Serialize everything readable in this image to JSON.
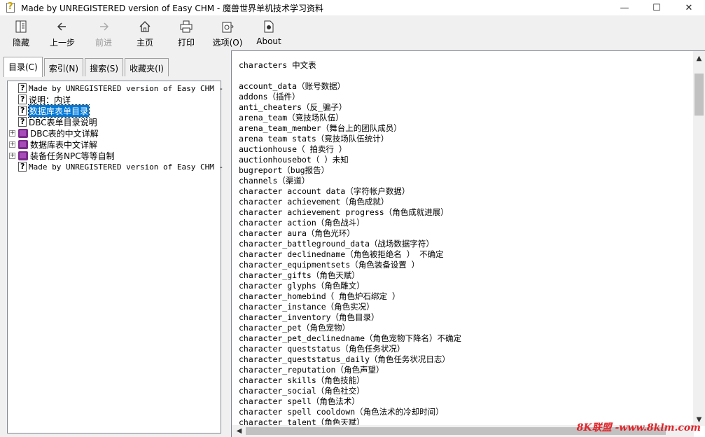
{
  "window": {
    "title": "Made by UNREGISTERED version of Easy CHM - 魔兽世界单机技术学习资料",
    "controls": {
      "minimize": "—",
      "maximize": "☐",
      "close": "✕"
    }
  },
  "toolbar": {
    "items": [
      {
        "label": "隐藏",
        "icon": "hide-icon",
        "enabled": true
      },
      {
        "label": "上一步",
        "icon": "back-arrow-icon",
        "enabled": true
      },
      {
        "label": "前进",
        "icon": "forward-arrow-icon",
        "enabled": false
      },
      {
        "label": "主页",
        "icon": "home-icon",
        "enabled": true
      },
      {
        "label": "打印",
        "icon": "printer-icon",
        "enabled": true
      },
      {
        "label": "选项(O)",
        "icon": "options-icon",
        "enabled": true
      },
      {
        "label": "About",
        "icon": "about-document-icon",
        "enabled": true
      }
    ]
  },
  "tabs": [
    {
      "label": "目录(C)",
      "active": true
    },
    {
      "label": "索引(N)",
      "active": false
    },
    {
      "label": "搜索(S)",
      "active": false
    },
    {
      "label": "收藏夹(I)",
      "active": false
    }
  ],
  "tree": [
    {
      "label": "Made by UNREGISTERED version of Easy CHM -",
      "type": "page",
      "expander": "",
      "selected": false
    },
    {
      "label": "说明：内详",
      "type": "page",
      "expander": "",
      "selected": false
    },
    {
      "label": "数据库表单目录",
      "type": "page",
      "expander": "",
      "selected": true
    },
    {
      "label": "DBC表单目录说明",
      "type": "page",
      "expander": "",
      "selected": false
    },
    {
      "label": "DBC表的中文详解",
      "type": "book",
      "expander": "+",
      "selected": false
    },
    {
      "label": "数据库表中文详解",
      "type": "book",
      "expander": "+",
      "selected": false
    },
    {
      "label": "装备任务NPC等等自制",
      "type": "book",
      "expander": "+",
      "selected": false
    },
    {
      "label": "Made by UNREGISTERED version of Easy CHM -",
      "type": "page",
      "expander": "",
      "selected": false
    }
  ],
  "content": {
    "heading": "characters 中文表",
    "lines": [
      "account_data（账号数据）",
      "addons（插件）",
      "anti_cheaters（反_骗子）",
      "arena_team（竞技场队伍）",
      "arena_team_member（舞台上的团队成员）",
      "arena team stats（竞技场队伍统计）",
      "auctionhouse（ 拍卖行 ）",
      "auctionhousebot（   ）未知",
      "bugreport（bug报告）",
      "channels（渠道）",
      "character account data（字符帐户数据）",
      "character achievement（角色成就）",
      "character achievement progress（角色成就进展）",
      "character action（角色战斗）",
      "character aura（角色光环）",
      "character_battleground_data（战场数据字符）",
      "character declinedname（角色被拒绝名 ） 不确定",
      "character_equipmentsets（角色装备设置 ）",
      "character_gifts（角色天赋）",
      "character glyphs（角色雕文）",
      "character_homebind（ 角色炉石绑定 ）",
      "character_instance（角色实况）",
      "character_inventory（角色目录）",
      "character_pet（角色宠物）",
      "character_pet_declinedname（角色宠物下降名）不确定",
      "character queststatus（角色任务状况）",
      "character_queststatus_daily（角色任务状况日志）",
      "character_reputation（角色声望）",
      "character skills（角色技能）",
      "character_social（角色社交）",
      "character spell（角色法术）",
      "character spell cooldown（角色法术的冷却时间）",
      "character talent（角色天赋）"
    ]
  },
  "watermark": "8K联盟 -www.8klm.com"
}
